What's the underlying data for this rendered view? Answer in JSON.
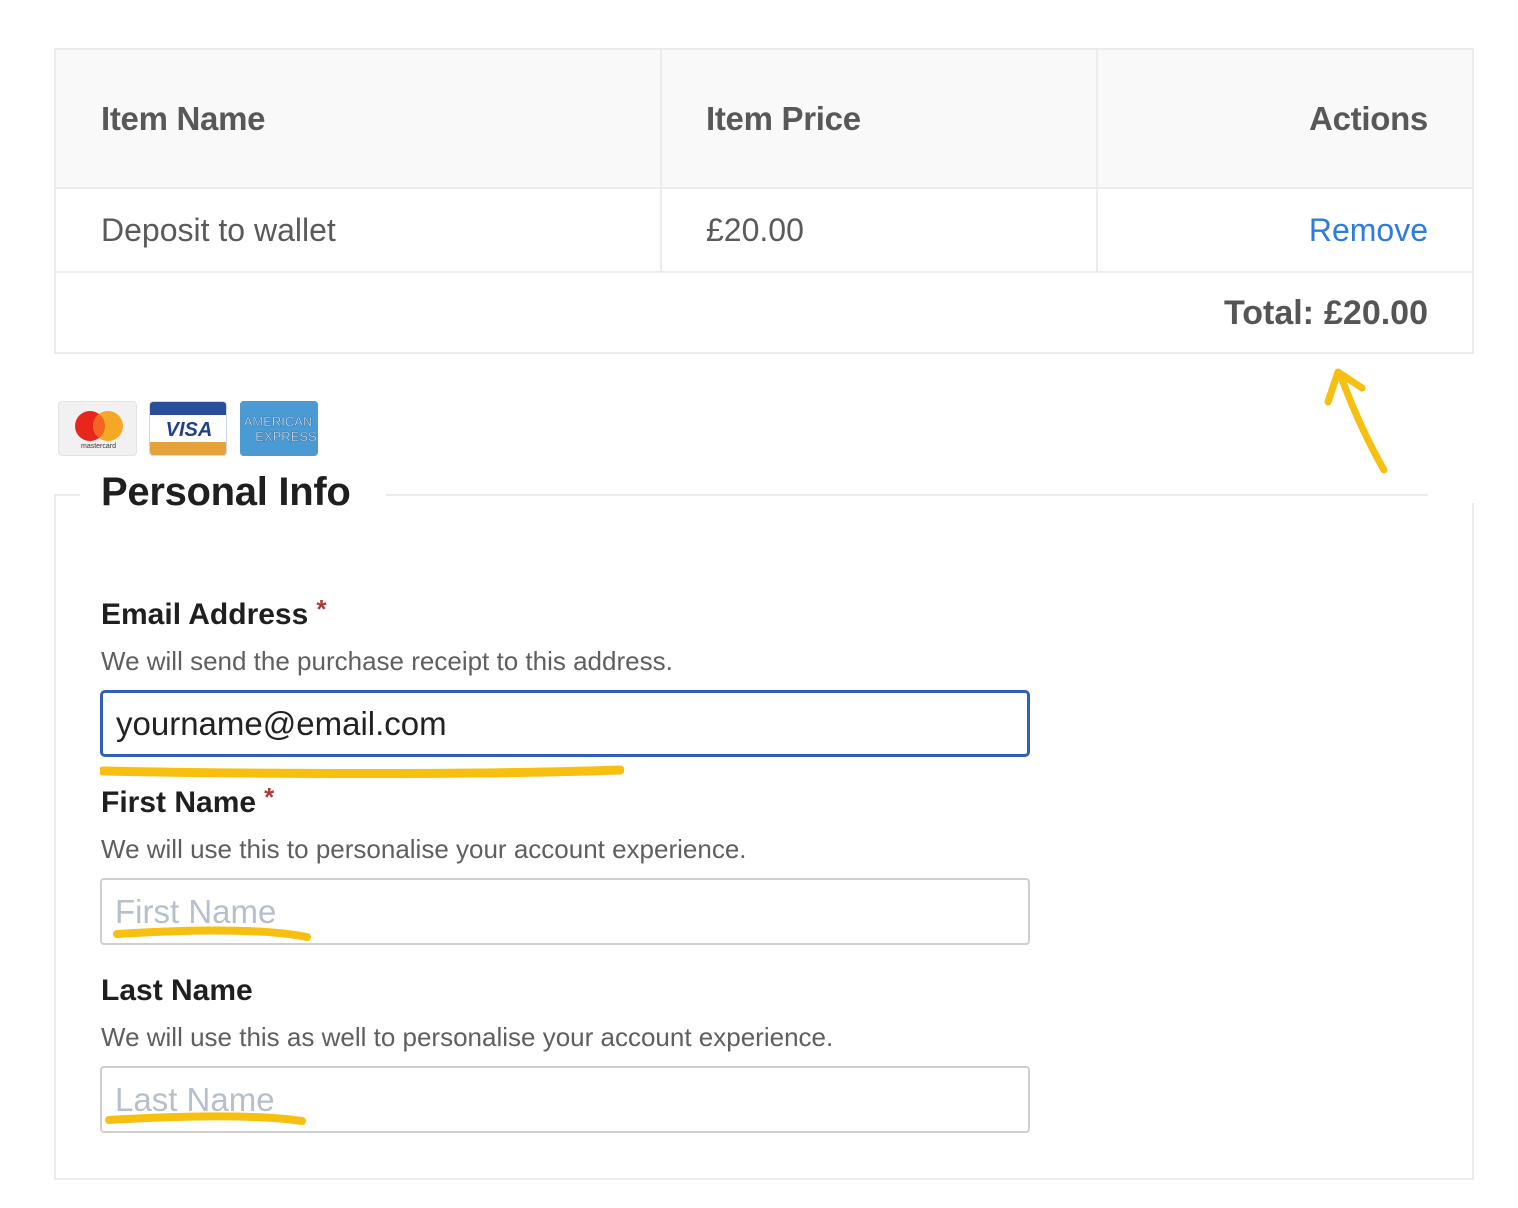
{
  "cart": {
    "headers": {
      "name": "Item Name",
      "price": "Item Price",
      "actions": "Actions"
    },
    "items": [
      {
        "name": "Deposit to wallet",
        "price": "£20.00",
        "action": "Remove"
      }
    ],
    "total_label": "Total:",
    "total_value": "£20.00"
  },
  "payment_icons": [
    "mastercard-logo",
    "visa-logo",
    "american-express-logo"
  ],
  "cards": {
    "mastercard": "mastercard",
    "visa": "VISA",
    "amex_line1": "AMERICAN",
    "amex_line2": "EXPRESS"
  },
  "personal_info": {
    "title": "Personal Info",
    "email": {
      "label": "Email Address",
      "required_mark": "*",
      "description": "We will send the purchase receipt to this address.",
      "value": "yourname@email.com",
      "placeholder": ""
    },
    "first_name": {
      "label": "First Name",
      "required_mark": "*",
      "description": "We will use this to personalise your account experience.",
      "value": "",
      "placeholder": "First Name"
    },
    "last_name": {
      "label": "Last Name",
      "description": "We will use this as well to personalise your account experience.",
      "value": "",
      "placeholder": "Last Name"
    }
  },
  "colors": {
    "link": "#2d7be0",
    "focus_border": "#2f5fb6",
    "required": "#b03a3a",
    "annotation": "#f7bf0f"
  }
}
